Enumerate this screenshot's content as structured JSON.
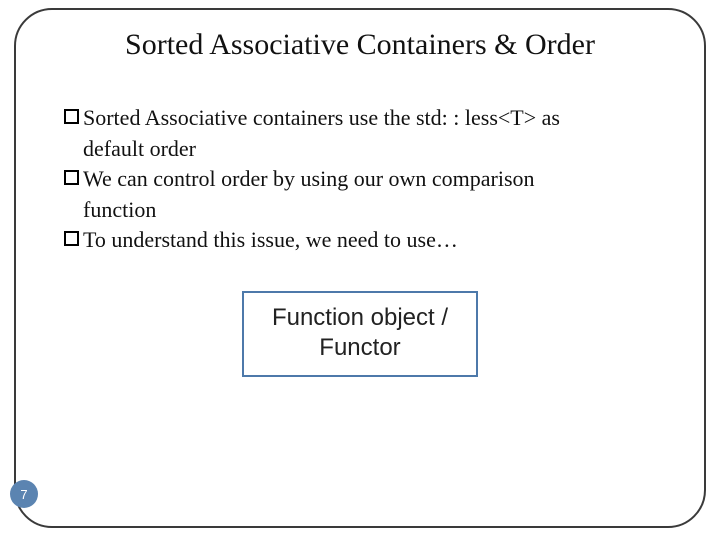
{
  "slide": {
    "title": "Sorted Associative Containers & Order",
    "bullets": [
      {
        "lead": "Sorted  Associative containers use the std: : less<T>  as",
        "cont": "default order"
      },
      {
        "lead": "We can control order by using our own comparison",
        "cont": "function"
      },
      {
        "lead": "To understand this issue, we need to use…",
        "cont": ""
      }
    ],
    "callout": {
      "line1": "Function object /",
      "line2": "Functor"
    },
    "page_number": "7"
  }
}
